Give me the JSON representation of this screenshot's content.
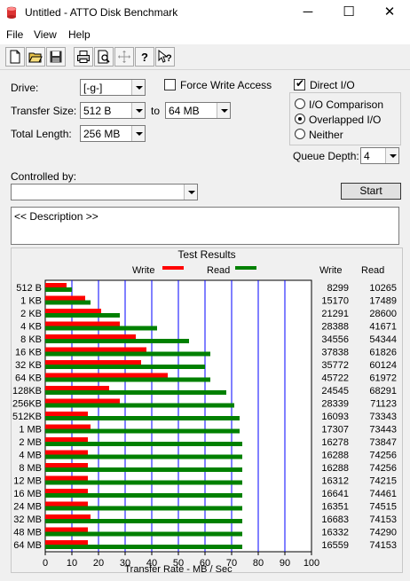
{
  "window": {
    "title": "Untitled - ATTO Disk Benchmark",
    "minimize": "─",
    "maximize": "☐",
    "close": "✕"
  },
  "menu": [
    "File",
    "View",
    "Help"
  ],
  "toolbar_icons": [
    "new-document-icon",
    "open-folder-icon",
    "save-icon",
    "print-icon",
    "print-preview-icon",
    "move-icon",
    "help-icon",
    "context-help-icon"
  ],
  "form": {
    "drive_label": "Drive:",
    "drive_value": "[-g-]",
    "transfer_size_label": "Transfer Size:",
    "transfer_from": "512 B",
    "to_label": "to",
    "transfer_to": "64 MB",
    "total_length_label": "Total Length:",
    "total_length_value": "256 MB",
    "force_write_label": "Force Write Access",
    "force_write_checked": false,
    "direct_io_label": "Direct I/O",
    "direct_io_checked": true,
    "io_options": [
      {
        "label": "I/O Comparison",
        "selected": false
      },
      {
        "label": "Overlapped I/O",
        "selected": true
      },
      {
        "label": "Neither",
        "selected": false
      }
    ],
    "queue_depth_label": "Queue Depth:",
    "queue_depth_value": "4",
    "controlled_by_label": "Controlled by:",
    "controlled_by_value": "",
    "start_label": "Start",
    "description": "<< Description >>"
  },
  "results": {
    "title": "Test Results",
    "write_legend": "Write",
    "read_legend": "Read",
    "write_header": "Write",
    "read_header": "Read",
    "xlabel": "Transfer Rate - MB / Sec"
  },
  "colors": {
    "write": "#ff0000",
    "read": "#008000",
    "grid": "#0000ff"
  },
  "chart_data": {
    "type": "bar",
    "orientation": "horizontal",
    "title": "Test Results",
    "xlabel": "Transfer Rate - MB / Sec",
    "xlim": [
      0,
      100
    ],
    "xticks": [
      "0",
      "10",
      "20",
      "30",
      "40",
      "50",
      "60",
      "70",
      "80",
      "90",
      "100"
    ],
    "grid": true,
    "legend_placement": "top",
    "categories": [
      "512 B",
      "1 KB",
      "2 KB",
      "4 KB",
      "8 KB",
      "16 KB",
      "32 KB",
      "64 KB",
      "128KB",
      "256KB",
      "512KB",
      "1 MB",
      "2 MB",
      "4 MB",
      "8 MB",
      "12 MB",
      "16 MB",
      "24 MB",
      "32 MB",
      "48 MB",
      "64 MB"
    ],
    "bar_values": {
      "write": [
        8,
        15,
        21,
        28,
        34,
        38,
        36,
        46,
        24,
        28,
        16,
        17,
        16,
        16,
        16,
        16,
        16,
        16,
        17,
        16,
        16
      ],
      "read": [
        10,
        17,
        28,
        42,
        54,
        62,
        60,
        62,
        68,
        71,
        73,
        73,
        74,
        74,
        74,
        74,
        74,
        74,
        74,
        74,
        74
      ]
    },
    "series": [
      {
        "name": "Write",
        "values": [
          8299,
          15170,
          21291,
          28388,
          34556,
          37838,
          35772,
          45722,
          24545,
          28339,
          16093,
          17307,
          16278,
          16288,
          16288,
          16312,
          16641,
          16351,
          16683,
          16332,
          16559
        ]
      },
      {
        "name": "Read",
        "values": [
          10265,
          17489,
          28600,
          41671,
          54344,
          61826,
          60124,
          61972,
          68291,
          71123,
          73343,
          73443,
          73847,
          74256,
          74256,
          74215,
          74461,
          74515,
          74153,
          74290,
          74153
        ]
      }
    ]
  }
}
